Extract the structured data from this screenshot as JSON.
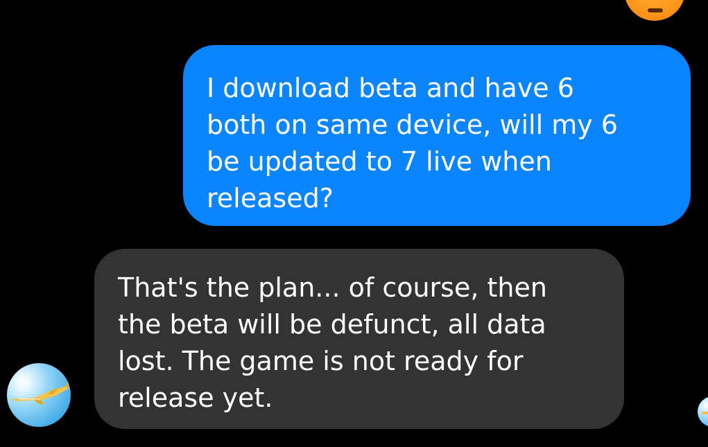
{
  "conversation": {
    "messages": [
      {
        "direction": "sent",
        "text": "I download beta and have 6\nboth on same device, will my 6\nbe updated to 7 live when\nreleased?"
      },
      {
        "direction": "received",
        "text": "That's the plan... of course, then\nthe beta will be defunct, all data\nlost.  The game is not ready for\nrelease yet."
      }
    ]
  },
  "icons": {
    "top_reaction": "expressionless-face-emoji-icon",
    "sender_avatar": "airplane-avatar-icon",
    "read_receipt": "airplane-read-receipt-icon"
  },
  "colors": {
    "background": "#000000",
    "sent_bubble": "#0a84ff",
    "received_bubble": "#333333",
    "text": "#ffffff"
  }
}
